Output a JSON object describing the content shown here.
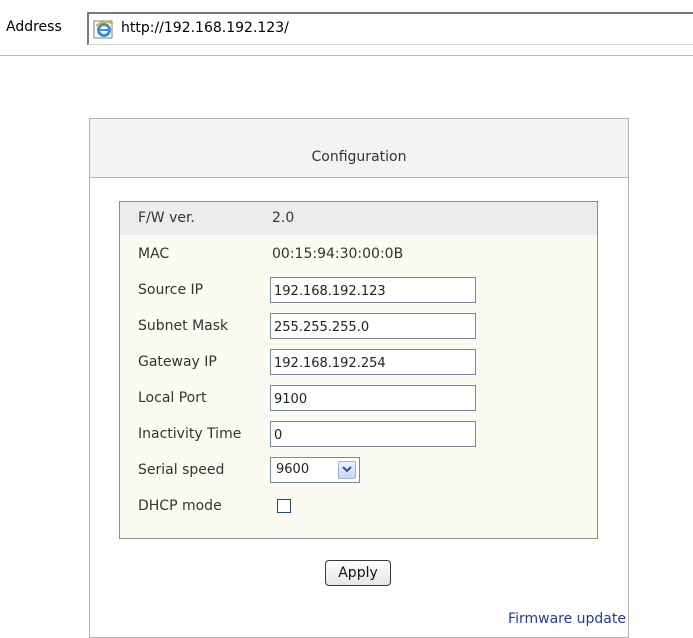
{
  "address_bar": {
    "label": "Address",
    "url": "http://192.168.192.123/"
  },
  "panel": {
    "title": "Configuration",
    "rows": [
      {
        "label": "F/W ver.",
        "value": "2.0"
      },
      {
        "label": "MAC",
        "value": "00:15:94:30:00:0B"
      },
      {
        "label": "Source IP",
        "value": "192.168.192.123"
      },
      {
        "label": "Subnet Mask",
        "value": "255.255.255.0"
      },
      {
        "label": "Gateway IP",
        "value": "192.168.192.254"
      },
      {
        "label": "Local Port",
        "value": "9100"
      },
      {
        "label": "Inactivity Time",
        "value": "0"
      },
      {
        "label": "Serial speed",
        "value": "9600"
      },
      {
        "label": "DHCP mode",
        "checked": false
      }
    ],
    "apply_label": "Apply",
    "firmware_link": "Firmware update"
  },
  "colors": {
    "link": "#1d3f93",
    "inner_background": "#fbfbf1",
    "shaded_row": "#ececec",
    "header_background": "#f3f3f3"
  },
  "icons": {
    "browser": "ie-page-icon",
    "dropdown": "chevron-down-icon"
  }
}
